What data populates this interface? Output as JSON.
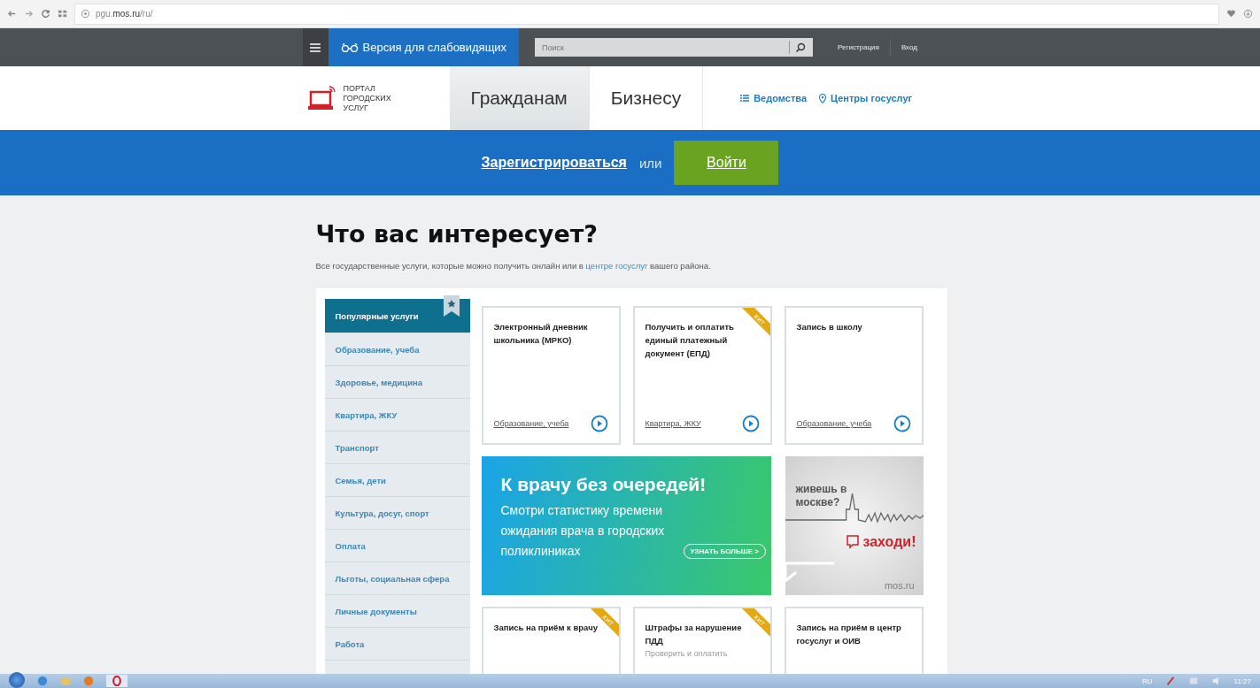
{
  "browser": {
    "address": "pgu.**mos.ru**/ru/"
  },
  "topbar": {
    "accessibility": "Версия для слабовидящих",
    "search": {
      "placeholder": "Поиск"
    },
    "register": "Регистрация",
    "login": "Вход"
  },
  "header": {
    "logo": "ПОРТАЛ ГОРОДСКИХ УСЛУГ",
    "tabs": [
      {
        "label": "Гражданам",
        "selected": true
      },
      {
        "label": "Бизнесу",
        "selected": false
      }
    ],
    "links": [
      {
        "kind": "list",
        "label": "Ведомства"
      },
      {
        "kind": "pin",
        "label": "Центры госуслуг"
      }
    ]
  },
  "auth_band": {
    "register": "Зарегистрироваться",
    "or": "или",
    "login": "Войти"
  },
  "main": {
    "title": "Что вас интересует?",
    "subtitle": [
      "Все государственные услуги, которые можно получить онлайн или в ",
      "центре госуслуг",
      " вашего района."
    ],
    "categories": [
      {
        "label": "Популярные услуги",
        "selected": true
      },
      {
        "label": "Образование, учеба",
        "selected": false
      },
      {
        "label": "Здоровье, медицина",
        "selected": false
      },
      {
        "label": "Квартира, ЖКУ",
        "selected": false
      },
      {
        "label": "Транспорт",
        "selected": false
      },
      {
        "label": "Семья, дети",
        "selected": false
      },
      {
        "label": "Культура, досуг, спорт",
        "selected": false
      },
      {
        "label": "Оплата",
        "selected": false
      },
      {
        "label": "Льготы, социальная сфера",
        "selected": false
      },
      {
        "label": "Личные документы",
        "selected": false
      },
      {
        "label": "Работа",
        "selected": false
      }
    ],
    "tiles": [
      {
        "kind": "service",
        "title": "Электронный дневник школьника (МРКО)",
        "category": "Образование, учеба",
        "hit": false
      },
      {
        "kind": "service",
        "title": "Получить и оплатить единый платежный документ (ЕПД)",
        "category": "Квартира, ЖКУ",
        "hit": true,
        "hit_label": "хит"
      },
      {
        "kind": "service",
        "title": "Запись в школу",
        "category": "Образование, учеба",
        "hit": false
      },
      {
        "kind": "promo",
        "title": "К врачу без очередей!",
        "text": "Смотри статистику времени ожидания врача в городских поликлиниках",
        "button": "УЗНАТЬ БОЛЬШЕ >"
      },
      {
        "kind": "city",
        "question": "живешь в москве?",
        "call": "заходи!",
        "site": "mos.ru"
      },
      {
        "kind": "service",
        "title": "Запись на приём к врачу",
        "hit": true,
        "hit_label": "хит"
      },
      {
        "kind": "service",
        "title": "Штрафы за нарушение ПДД",
        "subtitle": "Проверить и оплатить",
        "hit": true,
        "hit_label": "хит"
      },
      {
        "kind": "service",
        "title": "Запись на приём в центр госуслуг и ОИВ",
        "hit": false
      }
    ]
  },
  "taskbar": {
    "language": "RU",
    "clock": "11:27"
  }
}
